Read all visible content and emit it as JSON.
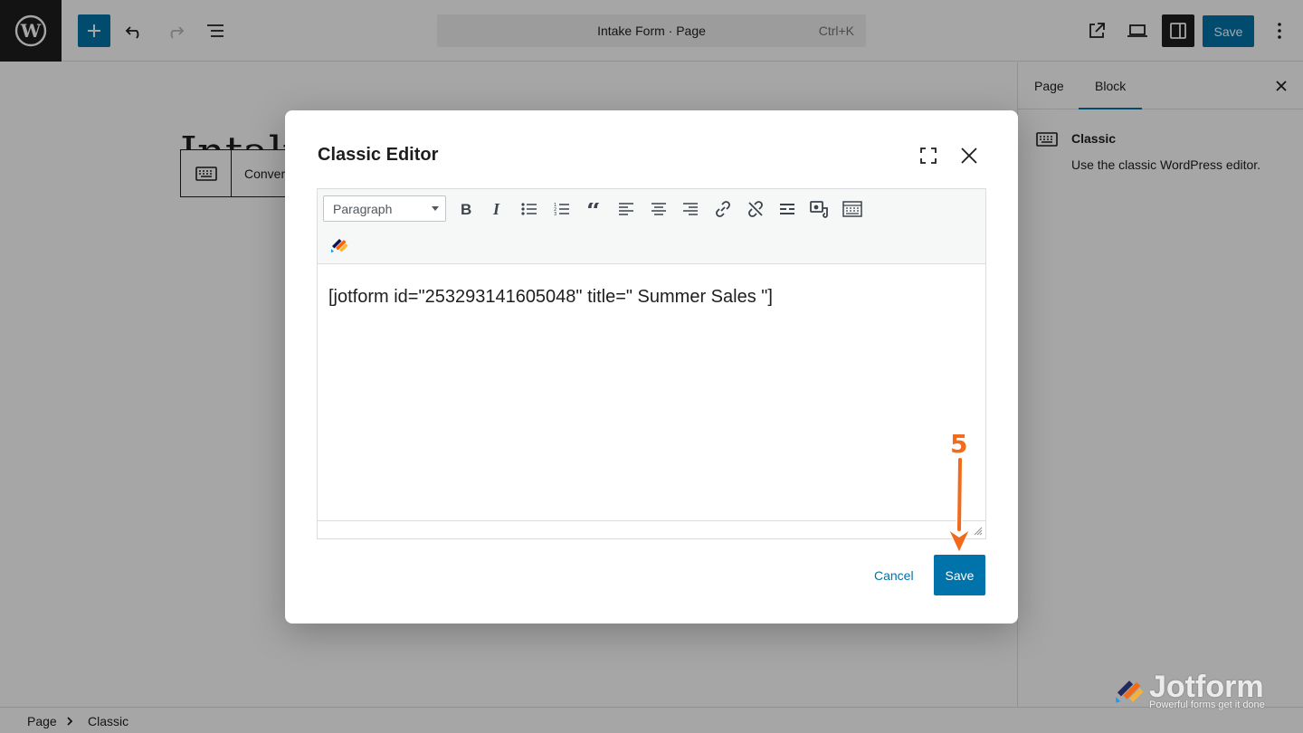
{
  "topbar": {
    "document_title": "Intake Form · Page",
    "shortcut": "Ctrl+K",
    "save_label": "Save",
    "accent_color": "#0073aa"
  },
  "canvas": {
    "heading_partial": "Intake",
    "block_toolbar_label": "Conver"
  },
  "sidebar": {
    "tabs": [
      {
        "label": "Page",
        "active": false
      },
      {
        "label": "Block",
        "active": true
      }
    ],
    "block": {
      "title": "Classic",
      "description": "Use the classic WordPress editor."
    }
  },
  "modal": {
    "title": "Classic Editor",
    "format_select": "Paragraph",
    "content": "[jotform id=\"253293141605048\" title=\" Summer Sales \"]",
    "cancel_label": "Cancel",
    "save_label": "Save"
  },
  "annotation": {
    "step_number": "5"
  },
  "footer": {
    "breadcrumb": [
      "Page",
      "Classic"
    ]
  },
  "watermark": {
    "brand": "Jotform",
    "tagline": "Powerful forms get it done"
  },
  "icons": [
    "wordpress-icon",
    "plus-icon",
    "undo-icon",
    "redo-icon",
    "document-overview-icon",
    "external-link-icon",
    "desktop-preview-icon",
    "sidebar-toggle-icon",
    "kebab-menu-icon",
    "keyboard-icon",
    "close-icon",
    "fullscreen-icon",
    "bold-icon",
    "italic-icon",
    "bullet-list-icon",
    "numbered-list-icon",
    "blockquote-icon",
    "align-left-icon",
    "align-center-icon",
    "align-right-icon",
    "link-icon",
    "unlink-icon",
    "read-more-icon",
    "add-media-icon",
    "toolbar-toggle-icon",
    "jotform-icon"
  ]
}
